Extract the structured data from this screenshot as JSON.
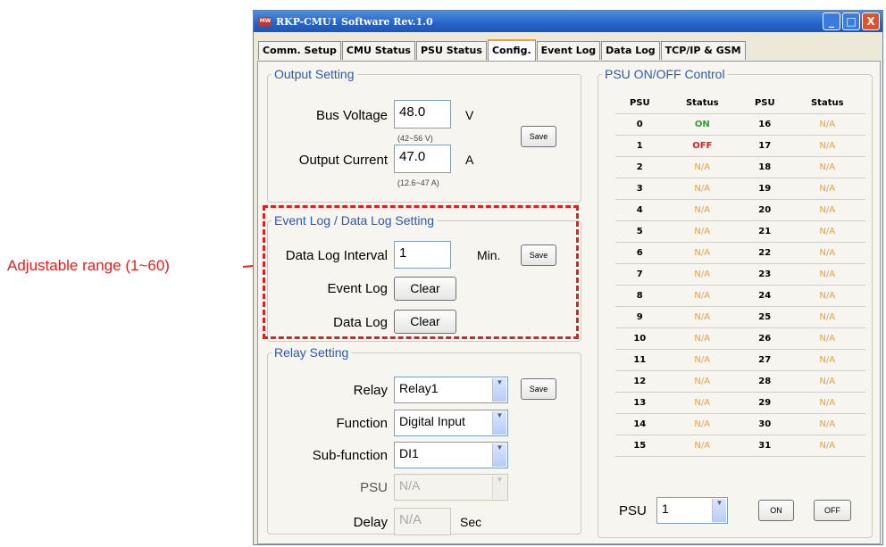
{
  "annotation": {
    "label": "Adjustable range (1~60)"
  },
  "window": {
    "title": "RKP-CMU1 Software  Rev.1.0",
    "icon_text": "MW",
    "minimize": "_",
    "maximize": "□",
    "close": "X"
  },
  "tabs": [
    "Comm. Setup",
    "CMU Status",
    "PSU Status",
    "Config.",
    "Event Log",
    "Data Log",
    "TCP/IP & GSM"
  ],
  "output_setting": {
    "legend": "Output Setting",
    "bus_voltage_label": "Bus Voltage",
    "bus_voltage_value": "48.0",
    "bus_voltage_unit": "V",
    "bus_voltage_range": "(42~56 V)",
    "output_current_label": "Output Current",
    "output_current_value": "47.0",
    "output_current_unit": "A",
    "output_current_range": "(12.6~47 A)",
    "save_label": "Save"
  },
  "log_setting": {
    "legend": "Event Log / Data Log Setting",
    "interval_label": "Data Log Interval",
    "interval_value": "1",
    "interval_unit": "Min.",
    "save_label": "Save",
    "event_log_label": "Event Log",
    "event_clear": "Clear",
    "data_log_label": "Data Log",
    "data_clear": "Clear"
  },
  "relay_setting": {
    "legend": "Relay Setting",
    "relay_label": "Relay",
    "relay_value": "Relay1",
    "save_label": "Save",
    "function_label": "Function",
    "function_value": "Digital Input",
    "subfunction_label": "Sub-function",
    "subfunction_value": "DI1",
    "psu_label": "PSU",
    "psu_value": "N/A",
    "delay_label": "Delay",
    "delay_value": "N/A",
    "delay_unit": "Sec"
  },
  "psu_control": {
    "legend": "PSU ON/OFF Control",
    "headers": [
      "PSU",
      "Status",
      "PSU",
      "Status"
    ],
    "rows": [
      [
        "0",
        "ON",
        "16",
        "N/A"
      ],
      [
        "1",
        "OFF",
        "17",
        "N/A"
      ],
      [
        "2",
        "N/A",
        "18",
        "N/A"
      ],
      [
        "3",
        "N/A",
        "19",
        "N/A"
      ],
      [
        "4",
        "N/A",
        "20",
        "N/A"
      ],
      [
        "5",
        "N/A",
        "21",
        "N/A"
      ],
      [
        "6",
        "N/A",
        "22",
        "N/A"
      ],
      [
        "7",
        "N/A",
        "23",
        "N/A"
      ],
      [
        "8",
        "N/A",
        "24",
        "N/A"
      ],
      [
        "9",
        "N/A",
        "25",
        "N/A"
      ],
      [
        "10",
        "N/A",
        "26",
        "N/A"
      ],
      [
        "11",
        "N/A",
        "27",
        "N/A"
      ],
      [
        "12",
        "N/A",
        "28",
        "N/A"
      ],
      [
        "13",
        "N/A",
        "29",
        "N/A"
      ],
      [
        "14",
        "N/A",
        "30",
        "N/A"
      ],
      [
        "15",
        "N/A",
        "31",
        "N/A"
      ]
    ],
    "psu_label": "PSU",
    "psu_value": "1",
    "on_label": "ON",
    "off_label": "OFF"
  },
  "colors": {
    "on": "#2ea12e",
    "off": "#e0201f",
    "na": "#f0a030",
    "annotation": "#e0201f",
    "legend": "#2a59b5"
  }
}
